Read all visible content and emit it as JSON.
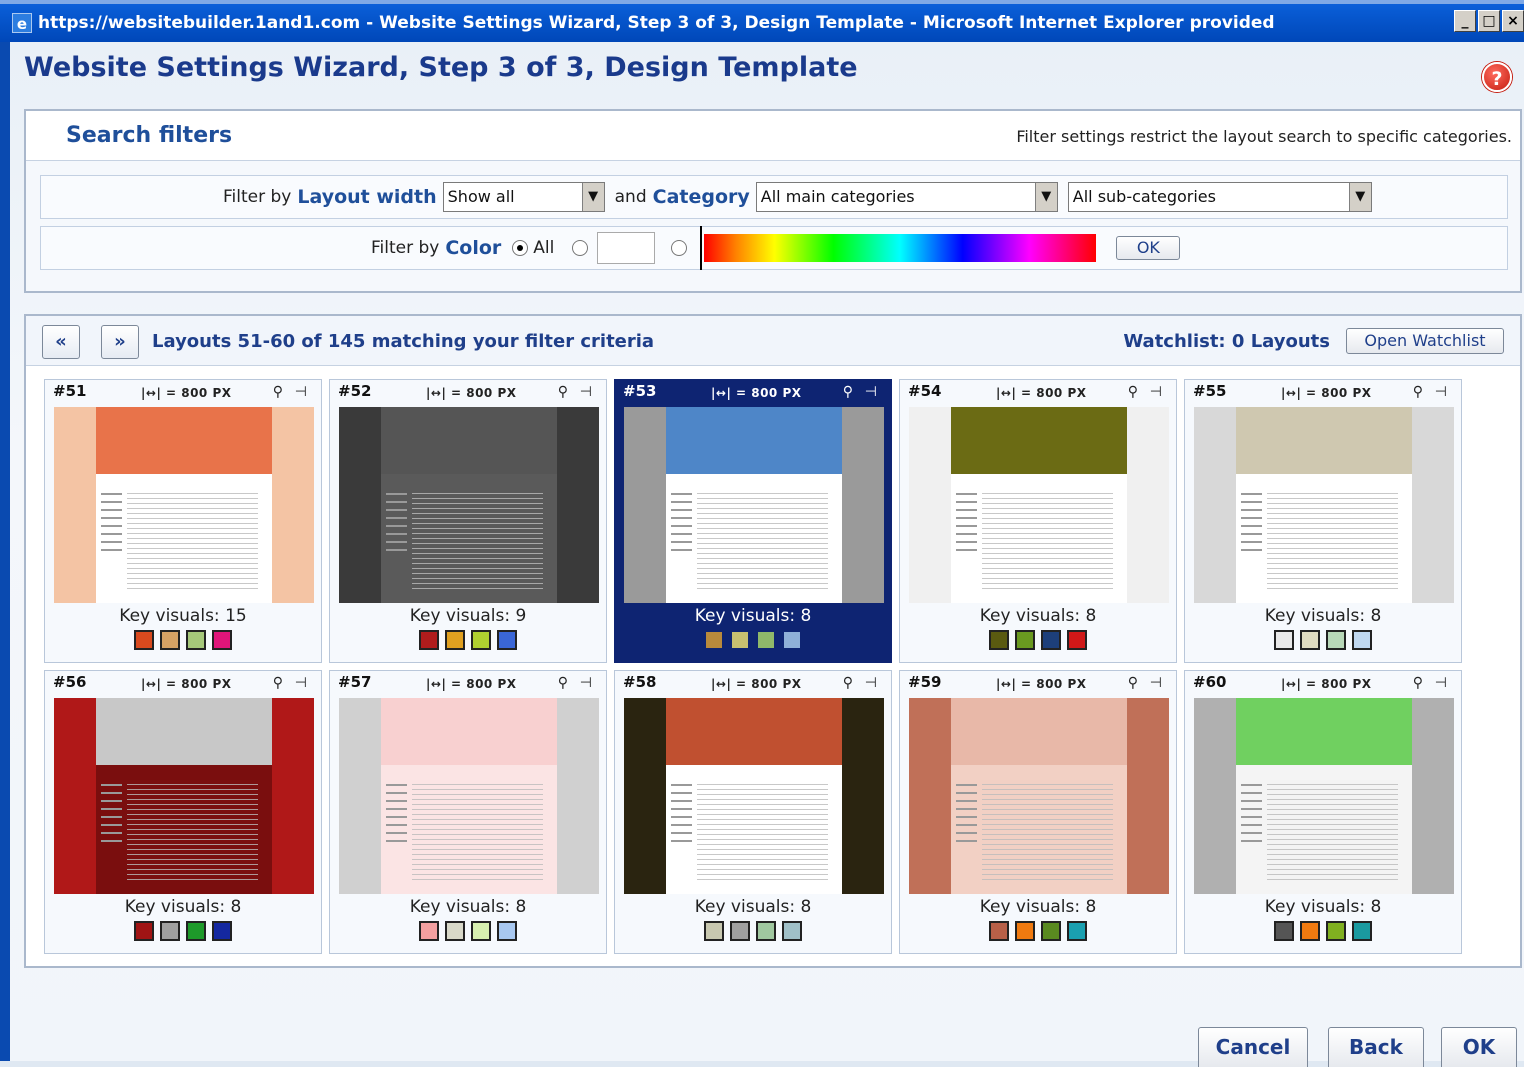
{
  "window": {
    "title": "https://websitebuilder.1and1.com - Website Settings Wizard, Step 3 of 3, Design Template - Microsoft Internet Explorer provided",
    "min_label": "_",
    "max_label": "□",
    "close_label": "×"
  },
  "page": {
    "title": "Website Settings Wizard, Step  3 of  3, Design Template",
    "help_icon": "?"
  },
  "filters": {
    "title": "Search filters",
    "note": "Filter settings restrict the layout search to specific categories.",
    "filter_by": "Filter by",
    "layout_width_label": "Layout width",
    "layout_width_value": "Show all",
    "and": "and",
    "category_label": "Category",
    "main_category_value": "All main categories",
    "sub_category_value": "All sub-categories",
    "color_label": "Color",
    "all_label": "All",
    "ok_label": "OK"
  },
  "results": {
    "prev_label": "«",
    "next_label": "»",
    "count_text": "Layouts 51-60 of 145 matching your filter criteria",
    "watchlist_text": "Watchlist: 0 Layouts",
    "open_watchlist_label": "Open Watchlist"
  },
  "layouts": [
    {
      "num": "#51",
      "width": "|↔| = 800 PX",
      "visuals": "Key visuals: 15",
      "swatches": [
        "#d94a1e",
        "#d6a264",
        "#a6c87a",
        "#e0157a"
      ],
      "theme": {
        "side": "#f4c4a4",
        "header": "#e8734a",
        "page": "#fff"
      }
    },
    {
      "num": "#52",
      "width": "|↔| = 800 PX",
      "visuals": "Key visuals: 9",
      "swatches": [
        "#b01c1c",
        "#e0a020",
        "#b0d030",
        "#3a66d6"
      ],
      "theme": {
        "side": "#3a3a3a",
        "header": "#555",
        "page": "#5a5a5a"
      }
    },
    {
      "num": "#53",
      "width": "|↔| = 800 PX",
      "visuals": "Key visuals: 8",
      "swatches": [
        "#b98a3c",
        "#c8c070",
        "#8fb86a",
        "#8fb0d8"
      ],
      "theme": {
        "side": "#9a9a9a",
        "header": "#4e86c8",
        "page": "#fff"
      }
    },
    {
      "num": "#54",
      "width": "|↔| = 800 PX",
      "visuals": "Key visuals: 8",
      "swatches": [
        "#5a5a10",
        "#6a9a20",
        "#1d3f7a",
        "#d01818"
      ],
      "theme": {
        "side": "#f0f0f0",
        "header": "#6b6b14",
        "page": "#fff"
      }
    },
    {
      "num": "#55",
      "width": "|↔| = 800 PX",
      "visuals": "Key visuals: 8",
      "swatches": [
        "#e8e8e8",
        "#e0dcc0",
        "#b8d8b8",
        "#c0d8f0"
      ],
      "theme": {
        "side": "#d8d8d8",
        "header": "#cfc8b0",
        "page": "#fff"
      }
    },
    {
      "num": "#56",
      "width": "|↔| = 800 PX",
      "visuals": "Key visuals: 8",
      "swatches": [
        "#a01414",
        "#a0a0a0",
        "#1e9a2a",
        "#1428a0"
      ],
      "theme": {
        "side": "#b01818",
        "header": "#c8c8c8",
        "page": "#7a0e0e"
      }
    },
    {
      "num": "#57",
      "width": "|↔| = 800 PX",
      "visuals": "Key visuals: 8",
      "swatches": [
        "#f4a0a0",
        "#d8d8c8",
        "#d8f0b0",
        "#a8c8f0"
      ],
      "theme": {
        "side": "#d0d0d0",
        "header": "#f8d0d0",
        "page": "#fbe4e4"
      }
    },
    {
      "num": "#58",
      "width": "|↔| = 800 PX",
      "visuals": "Key visuals: 8",
      "swatches": [
        "#c8c8b0",
        "#a0a0a0",
        "#a0c8a0",
        "#a0c0c8"
      ],
      "theme": {
        "side": "#2a2410",
        "header": "#c05030",
        "page": "#fff"
      }
    },
    {
      "num": "#59",
      "width": "|↔| = 800 PX",
      "visuals": "Key visuals: 8",
      "swatches": [
        "#b86048",
        "#f07a10",
        "#5a8a20",
        "#1aa0b0"
      ],
      "theme": {
        "side": "#c07058",
        "header": "#e8b8a8",
        "page": "#f2d0c4"
      }
    },
    {
      "num": "#60",
      "width": "|↔| = 800 PX",
      "visuals": "Key visuals: 8",
      "swatches": [
        "#555555",
        "#f07a10",
        "#80b020",
        "#1a9aa0"
      ],
      "theme": {
        "side": "#b0b0b0",
        "header": "#70d060",
        "page": "#f4f4f4"
      }
    }
  ],
  "footer": {
    "cancel_label": "Cancel",
    "back_label": "Back",
    "ok_label": "OK"
  },
  "colors": {
    "accent": "#1f4f9a",
    "selected_card": "#0e2472",
    "titlebar": "#0a5fd9"
  }
}
